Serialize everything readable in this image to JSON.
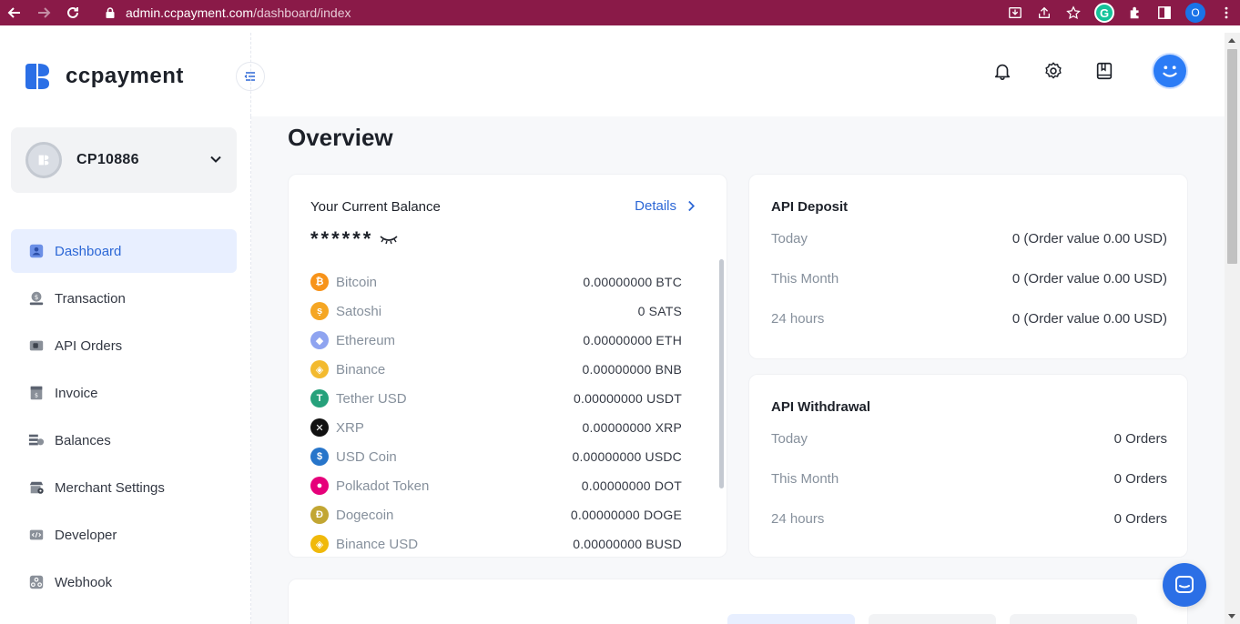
{
  "browser": {
    "url_host": "admin.ccpayment.com",
    "url_path": "/dashboard/index",
    "profile_initial": "O",
    "grammarly_letter": "G"
  },
  "app": {
    "brand": "ccpayment",
    "accent_color": "#2c67d6"
  },
  "account": {
    "name": "CP10886"
  },
  "sidebar": {
    "items": [
      {
        "label": "Dashboard",
        "icon": "dashboard-icon",
        "active": true
      },
      {
        "label": "Transaction",
        "icon": "transaction-icon"
      },
      {
        "label": "API Orders",
        "icon": "api-orders-icon"
      },
      {
        "label": "Invoice",
        "icon": "invoice-icon"
      },
      {
        "label": "Balances",
        "icon": "balances-icon"
      },
      {
        "label": "Merchant Settings",
        "icon": "merchant-settings-icon"
      },
      {
        "label": "Developer",
        "icon": "developer-icon"
      },
      {
        "label": "Webhook",
        "icon": "webhook-icon"
      }
    ]
  },
  "main": {
    "title": "Overview",
    "balance": {
      "title": "Your Current Balance",
      "details_label": "Details",
      "masked_value": "******",
      "coins": [
        {
          "name": "Bitcoin",
          "amount": "0.00000000 BTC",
          "color": "#f7931a",
          "glyph": "₿"
        },
        {
          "name": "Satoshi",
          "amount": "0 SATS",
          "color": "#f5a623",
          "glyph": "ṣ"
        },
        {
          "name": "Ethereum",
          "amount": "0.00000000 ETH",
          "color": "#8fa4f0",
          "glyph": "◆"
        },
        {
          "name": "Binance",
          "amount": "0.00000000 BNB",
          "color": "#f3ba2f",
          "glyph": "◈"
        },
        {
          "name": "Tether USD",
          "amount": "0.00000000 USDT",
          "color": "#26a17b",
          "glyph": "T"
        },
        {
          "name": "XRP",
          "amount": "0.00000000 XRP",
          "color": "#111111",
          "glyph": "✕"
        },
        {
          "name": "USD Coin",
          "amount": "0.00000000 USDC",
          "color": "#2775ca",
          "glyph": "$"
        },
        {
          "name": "Polkadot Token",
          "amount": "0.00000000 DOT",
          "color": "#e6007a",
          "glyph": "●"
        },
        {
          "name": "Dogecoin",
          "amount": "0.00000000 DOGE",
          "color": "#c2a633",
          "glyph": "Ð"
        },
        {
          "name": "Binance USD",
          "amount": "0.00000000 BUSD",
          "color": "#f0b90b",
          "glyph": "◈"
        }
      ]
    },
    "api_deposit": {
      "title": "API Deposit",
      "rows": [
        {
          "label": "Today",
          "value": "0 (Order value 0.00 USD)"
        },
        {
          "label": "This Month",
          "value": "0 (Order value 0.00 USD)"
        },
        {
          "label": "24 hours",
          "value": "0 (Order value 0.00 USD)"
        }
      ]
    },
    "api_withdrawal": {
      "title": "API Withdrawal",
      "rows": [
        {
          "label": "Today",
          "value": "0 Orders"
        },
        {
          "label": "This Month",
          "value": "0 Orders"
        },
        {
          "label": "24 hours",
          "value": "0 Orders"
        }
      ]
    }
  }
}
